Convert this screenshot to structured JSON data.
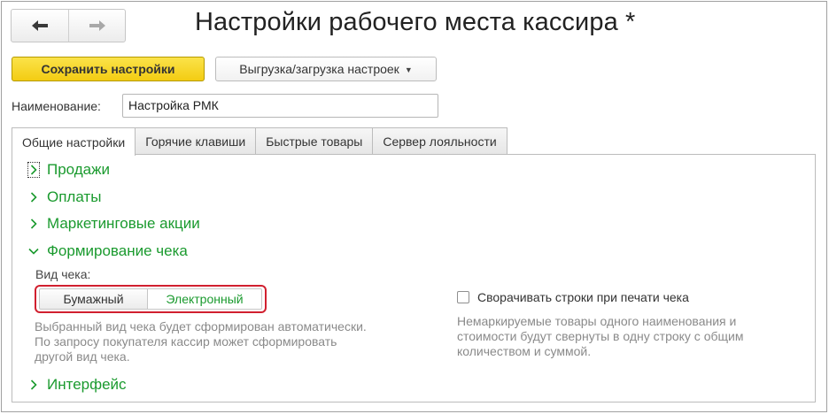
{
  "window": {
    "title": "Настройки рабочего места кассира *"
  },
  "toolbar": {
    "back_icon": "arrow-left-icon",
    "forward_icon": "arrow-right-icon",
    "save_label": "Сохранить настройки",
    "export_label": "Выгрузка/загрузка настроек",
    "export_icon": "chevron-down-icon"
  },
  "name_field": {
    "label": "Наименование:",
    "value": "Настройка РМК"
  },
  "tabs": [
    {
      "label": "Общие настройки",
      "active": true
    },
    {
      "label": "Горячие клавиши",
      "active": false
    },
    {
      "label": "Быстрые товары",
      "active": false
    },
    {
      "label": "Сервер лояльности",
      "active": false
    }
  ],
  "groups": {
    "sales": "Продажи",
    "payments": "Оплаты",
    "marketing": "Маркетинговые акции",
    "receipt": "Формирование чека",
    "interface": "Интерфейс"
  },
  "receipt": {
    "type_label": "Вид чека:",
    "options": [
      "Бумажный",
      "Электронный"
    ],
    "selected": "Электронный",
    "hint_lines": [
      "Выбранный вид чека будет сформирован автоматически.",
      "По запросу покупателя кассир может сформировать",
      "другой вид чека."
    ],
    "collapse_label": "Сворачивать строки при печати чека",
    "collapse_checked": false,
    "collapse_hint_lines": [
      "Немаркируемые товары одного наименования и",
      "стоимости будут свернуты в одну строку с общим",
      "количеством и суммой."
    ]
  },
  "colors": {
    "accent_green": "#1a9a2e",
    "save_yellow": "#f3cc12",
    "highlight_red": "#d1202f"
  }
}
